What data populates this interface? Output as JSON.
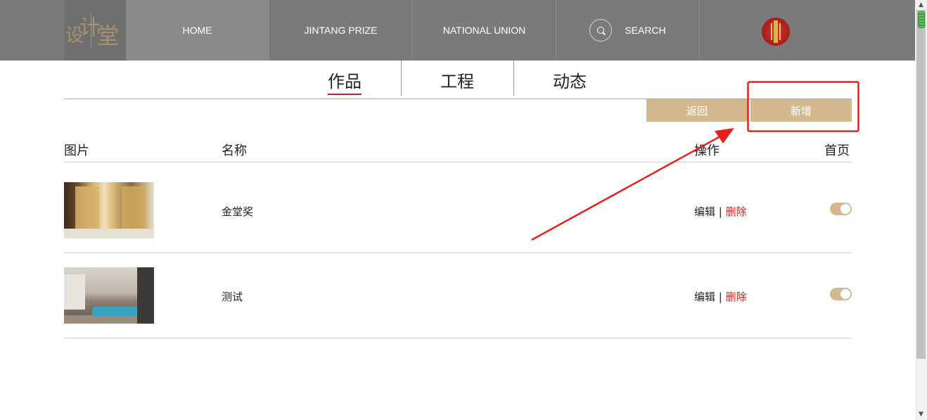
{
  "logo": {
    "chars": [
      "设",
      "计",
      "堂"
    ]
  },
  "nav": {
    "items": [
      {
        "label": "HOME"
      },
      {
        "label": "JINTANG PRIZE"
      },
      {
        "label": "NATIONAL UNION"
      },
      {
        "label": "SEARCH"
      }
    ]
  },
  "subnav": {
    "tabs": [
      {
        "label": "作品",
        "active": true
      },
      {
        "label": "工程",
        "active": false
      },
      {
        "label": "动态",
        "active": false
      }
    ]
  },
  "actions": {
    "back_label": "返回",
    "add_label": "新增"
  },
  "table": {
    "headers": {
      "image": "图片",
      "name": "名称",
      "actions": "操作",
      "homepage": "首页"
    },
    "rows": [
      {
        "name": "金堂奖",
        "edit": "编辑",
        "sep": "|",
        "delete": "删除",
        "homepage_on": true
      },
      {
        "name": "测试",
        "edit": "编辑",
        "sep": "|",
        "delete": "删除",
        "homepage_on": true
      }
    ]
  },
  "colors": {
    "topbar": "#7a7a7a",
    "accent_tan": "#d4b98f",
    "delete_red": "#cc2222",
    "annotation_red": "#e8201a"
  }
}
